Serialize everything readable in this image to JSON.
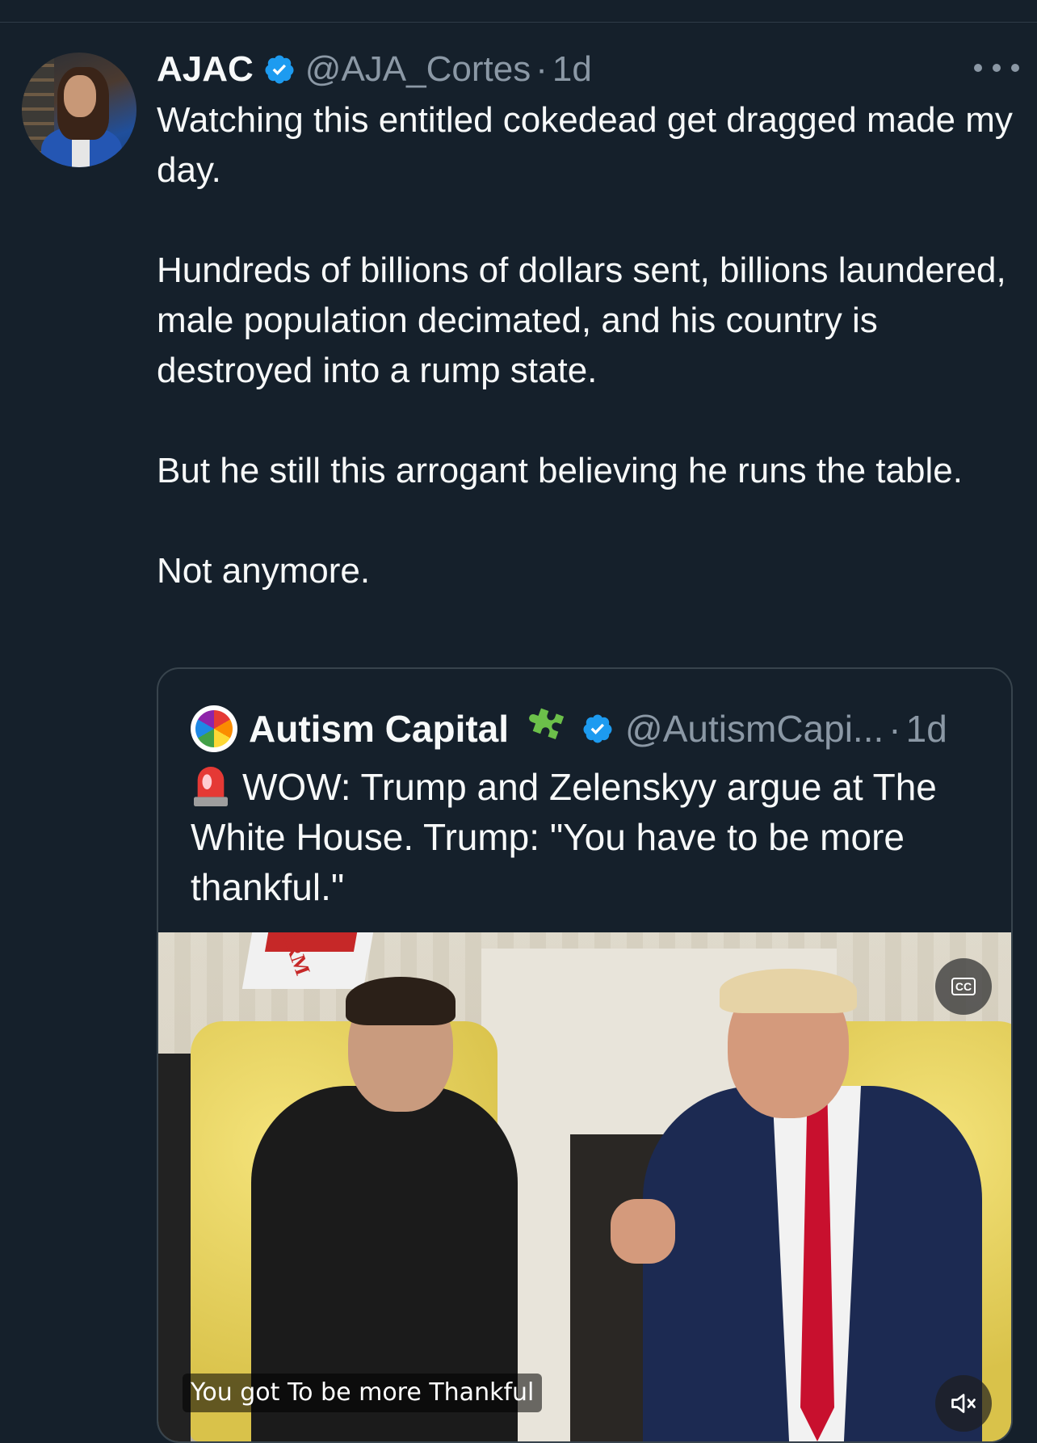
{
  "tweet": {
    "author_name": "AJAC",
    "handle": "@AJA_Cortes",
    "separator": "·",
    "time": "1d",
    "paragraphs": [
      "Watching this entitled cokedead get dragged made my day.",
      "Hundreds of billions of dollars sent, billions laundered, male population decimated, and his country is destroyed into a rump state.",
      "But he still this arrogant believing he runs the table.",
      "Not anymore."
    ]
  },
  "quoted_tweet": {
    "author_name": "Autism Capital",
    "handle": "@AutismCapi...",
    "separator": "·",
    "time": "1d",
    "text": "WOW: Trump and Zelenskyy argue at The White House. Trump: \"You have to be more thankful.\"",
    "video": {
      "caption": "You got To be more Thankful",
      "cc_label": "CC",
      "flag_text": "ARM"
    }
  },
  "colors": {
    "background": "#15202b",
    "text": "#f7f9f9",
    "secondary_text": "#8b98a5",
    "verified_blue": "#1d9bf0",
    "border": "#38444d"
  },
  "icons": [
    "verified-badge-icon",
    "more-options-icon",
    "puzzle-piece-icon",
    "siren-icon",
    "closed-captions-icon",
    "mute-icon"
  ]
}
